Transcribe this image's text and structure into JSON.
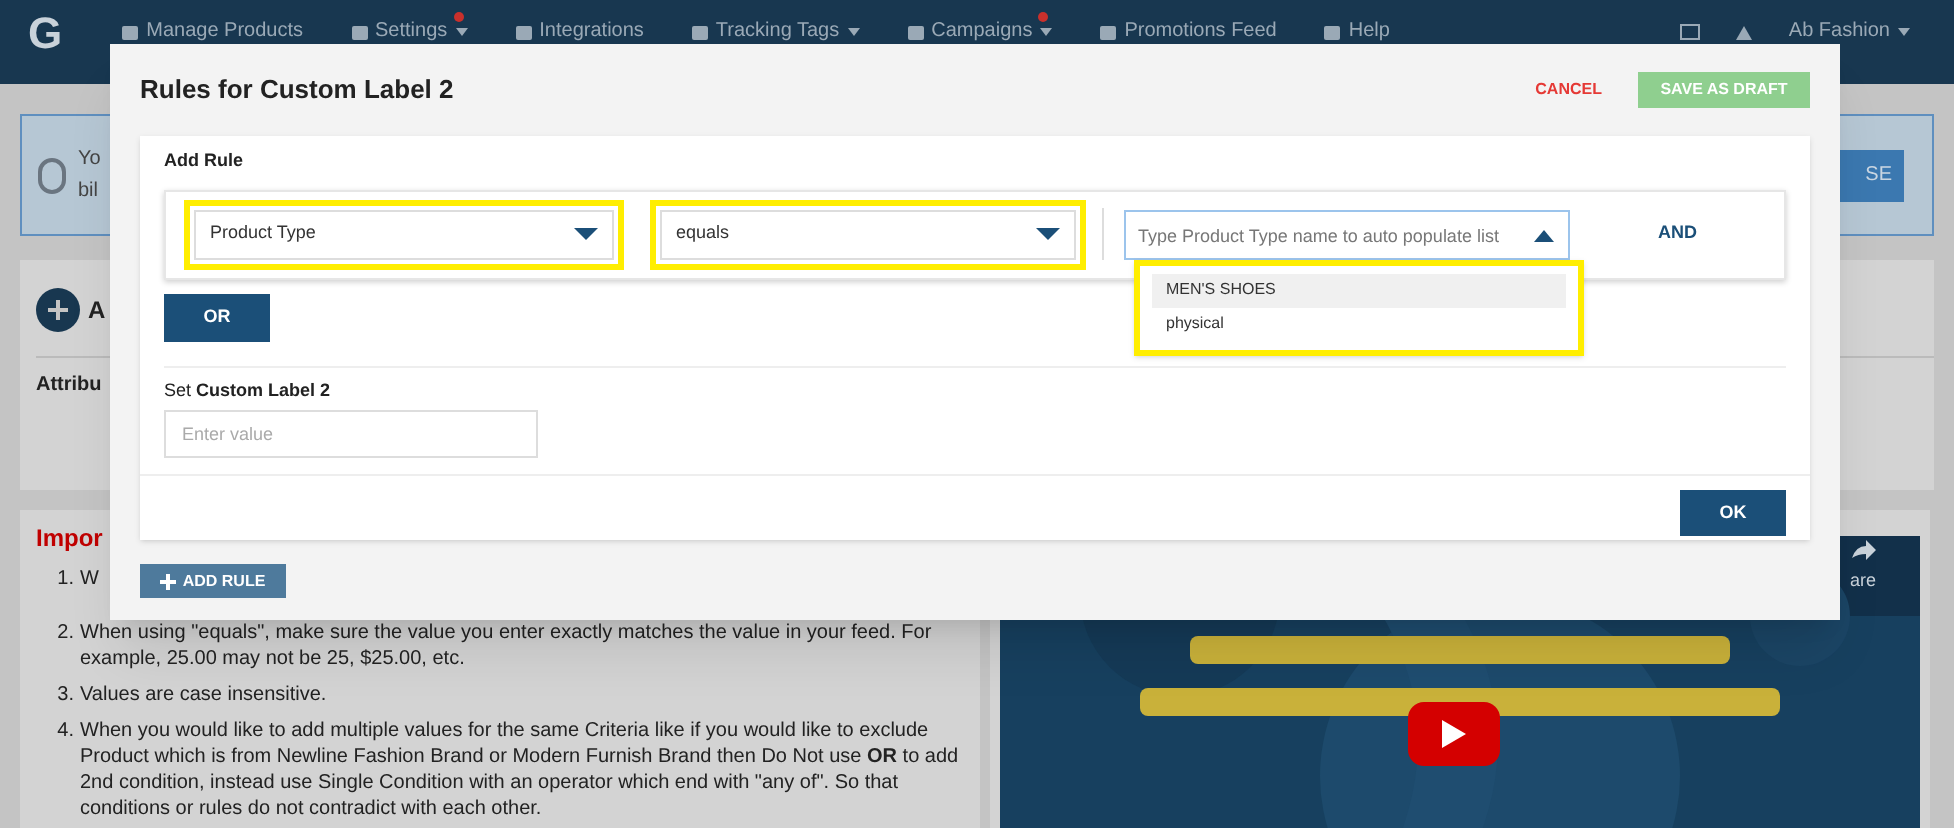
{
  "nav": {
    "logo": "G",
    "items": [
      {
        "label": "Manage Products",
        "notification": false,
        "has_menu": false
      },
      {
        "label": "Settings",
        "notification": true,
        "has_menu": true
      },
      {
        "label": "Integrations",
        "notification": false,
        "has_menu": false
      },
      {
        "label": "Tracking Tags",
        "notification": false,
        "has_menu": true
      },
      {
        "label": "Campaigns",
        "notification": true,
        "has_menu": true
      },
      {
        "label": "Promotions Feed",
        "notification": false,
        "has_menu": false
      },
      {
        "label": "Help",
        "notification": false,
        "has_menu": false
      }
    ],
    "account": "Ab Fashion"
  },
  "background": {
    "banner": {
      "line_1": "Yo",
      "line_2": "bil",
      "button": "SE"
    },
    "attributes_card": {
      "heading": "A",
      "column_1": "Attribu"
    },
    "important": {
      "heading": "Impor",
      "items": [
        {
          "number": "1.",
          "text": "W"
        },
        {
          "number": "2.",
          "text": "When using \"equals\", make sure the value you enter exactly matches the value in your feed. For example, 25.00 may not be 25, $25.00, etc."
        },
        {
          "number": "3.",
          "text": "Values are case insensitive."
        },
        {
          "number": "4.",
          "text": "When you would like to add multiple values for the same Criteria like if you would like to exclude Product which is from Newline Fashion Brand or Modern Furnish Brand then Do Not use **OR** to add 2nd condition, instead use Single Condition with an operator which end with \"any of\". So that conditions or rules do not contradict with each other."
        }
      ]
    },
    "video": {
      "kind": "picture",
      "share_label": "are"
    }
  },
  "modal": {
    "title": "Rules for Custom Label 2",
    "cancel": "CANCEL",
    "save_draft": {
      "label": "SAVE AS DRAFT",
      "disabled": true
    },
    "section_title": "Add Rule",
    "rule": {
      "attribute": {
        "value": "Product Type",
        "highlighted": true
      },
      "operator": {
        "value": "equals",
        "highlighted": true
      },
      "value_field": {
        "placeholder": "Type Product Type name to auto populate list",
        "expanded": true
      },
      "suggestions": {
        "highlighted": true,
        "items": [
          {
            "label": "MEN'S SHOES",
            "selected": true
          },
          {
            "label": "physical",
            "selected": false
          }
        ]
      },
      "and": "AND"
    },
    "or_button": "OR",
    "set_label": "Set **Custom Label 2**",
    "value_input": {
      "placeholder": "Enter value"
    },
    "ok": "OK",
    "add_rule": "ADD RULE"
  }
}
